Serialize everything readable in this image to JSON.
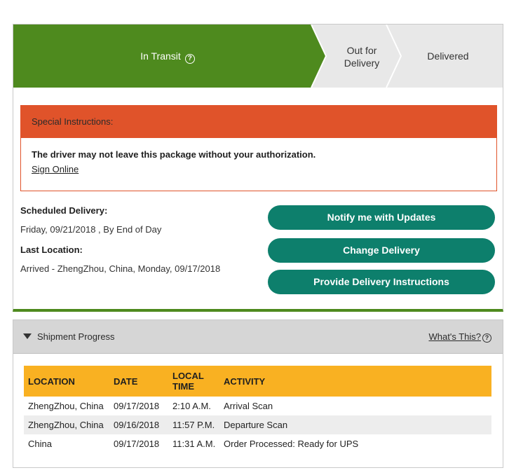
{
  "tracker": {
    "steps": [
      {
        "label": "In Transit",
        "status": "active"
      },
      {
        "label": "Out for Delivery",
        "line1": "Out for",
        "line2": "Delivery",
        "status": "pending"
      },
      {
        "label": "Delivered",
        "status": "pending"
      }
    ],
    "help_icon_glyph": "?",
    "colors": {
      "active": "#4e8a1e",
      "pending": "#e8e8e8",
      "special": "#e0532a",
      "button": "#0d7f6c",
      "table_header": "#f9b122"
    }
  },
  "special_instructions": {
    "heading": "Special Instructions:",
    "message": "The driver may not leave this package without your authorization.",
    "link": "Sign Online"
  },
  "delivery": {
    "scheduled_label": "Scheduled Delivery:",
    "scheduled_value": "Friday, 09/21/2018 , By End of Day",
    "last_location_label": "Last Location:",
    "last_location_value": "Arrived - ZhengZhou, China, Monday, 09/17/2018"
  },
  "actions": {
    "notify": "Notify me with Updates",
    "change": "Change Delivery",
    "instructions": "Provide Delivery Instructions"
  },
  "shipment_progress": {
    "toggle_label": "Shipment Progress",
    "help_link": "What's This?",
    "help_icon_glyph": "?",
    "columns": {
      "location": "LOCATION",
      "date": "DATE",
      "time_line1": "LOCAL",
      "time_line2": "TIME",
      "activity": "ACTIVITY"
    },
    "rows": [
      {
        "location": "ZhengZhou,  China",
        "date": "09/17/2018",
        "time": "2:10 A.M.",
        "activity": "Arrival Scan"
      },
      {
        "location": "ZhengZhou,  China",
        "date": "09/16/2018",
        "time": "11:57 P.M.",
        "activity": "Departure Scan"
      },
      {
        "location": "China",
        "date": "09/17/2018",
        "time": "11:31 A.M.",
        "activity": "Order Processed: Ready for UPS"
      }
    ]
  }
}
